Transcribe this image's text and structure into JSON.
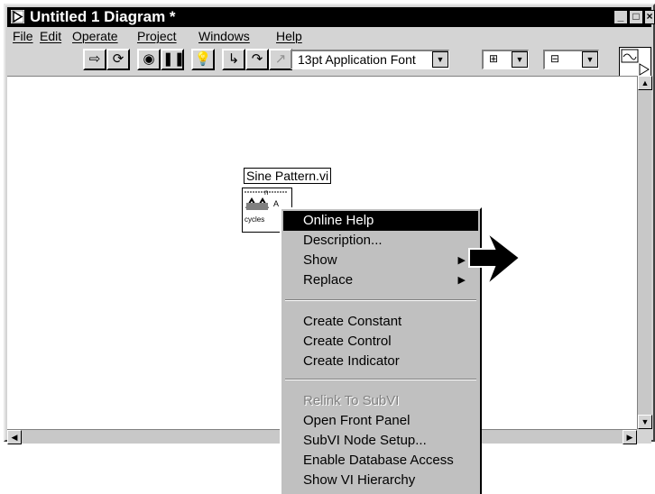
{
  "window": {
    "title": "Untitled 1 Diagram *",
    "controls": {
      "minimize": "_",
      "maximize": "□",
      "close": "×"
    }
  },
  "menubar": [
    {
      "label": "File"
    },
    {
      "label": "Edit"
    },
    {
      "label": "Operate"
    },
    {
      "label": "Project"
    },
    {
      "label": "Windows"
    },
    {
      "label": "Help"
    }
  ],
  "toolbar": {
    "font": "13pt Application Font",
    "connector_pane_number": "1"
  },
  "diagram": {
    "node_label": "Sine Pattern.vi",
    "icon_text_top": "n",
    "icon_text_left": "A",
    "icon_text_bottom": "cycles"
  },
  "context_menu": {
    "items": [
      {
        "label": "Online Help",
        "highlighted": true
      },
      {
        "label": "Description..."
      },
      {
        "label": "Show",
        "submenu": true
      },
      {
        "label": "Replace",
        "submenu": true
      },
      {
        "label": "Create Constant"
      },
      {
        "label": "Create Control"
      },
      {
        "label": "Create Indicator"
      },
      {
        "label": "Relink To SubVI",
        "disabled": true
      },
      {
        "label": "Open Front Panel"
      },
      {
        "label": "SubVI Node Setup..."
      },
      {
        "label": "Enable Database Access"
      },
      {
        "label": "Show VI Hierarchy"
      }
    ]
  }
}
